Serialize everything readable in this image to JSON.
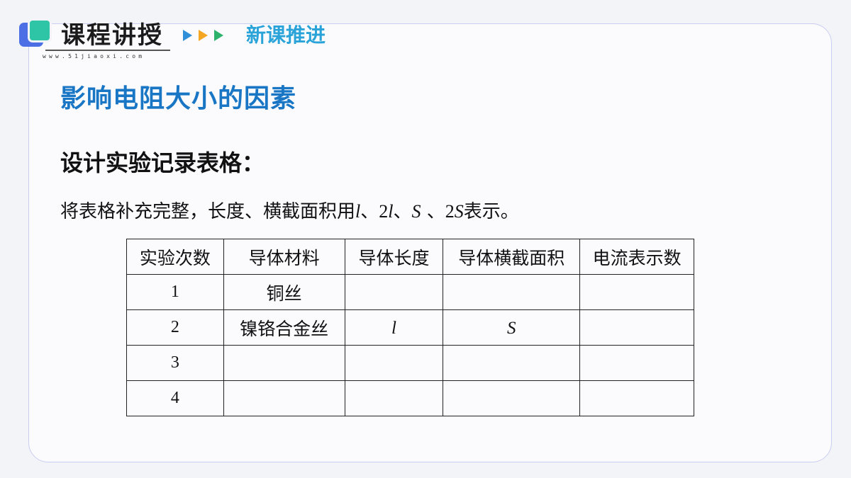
{
  "header": {
    "title": "课程讲授",
    "url": "www.51jiaoxi.com",
    "section": "新课推进"
  },
  "main": {
    "title": "影响电阻大小的因素",
    "subheading": "设计实验记录表格：",
    "instruction": {
      "prefix": "将表格补充完整，长度、横截面积用",
      "l": "l",
      "sep1": "、",
      "two": "2",
      "l2": "l",
      "sep2": "、",
      "S": "S",
      "sep3": " 、",
      "two2": "2",
      "S2": "S",
      "suffix": "表示。"
    }
  },
  "table": {
    "headers": [
      "实验次数",
      "导体材料",
      "导体长度",
      "导体横截面积",
      "电流表示数"
    ],
    "rows": [
      [
        "1",
        "铜丝",
        "",
        "",
        ""
      ],
      [
        "2",
        "镍铬合金丝",
        "l",
        "S",
        ""
      ],
      [
        "3",
        "",
        "",
        "",
        ""
      ],
      [
        "4",
        "",
        "",
        "",
        ""
      ]
    ]
  },
  "colors": {
    "title_blue": "#1976c4",
    "section_blue": "#29a3d8",
    "arrow_blue": "#2f8fd9",
    "arrow_orange": "#f5a623",
    "arrow_green": "#2db36c"
  }
}
